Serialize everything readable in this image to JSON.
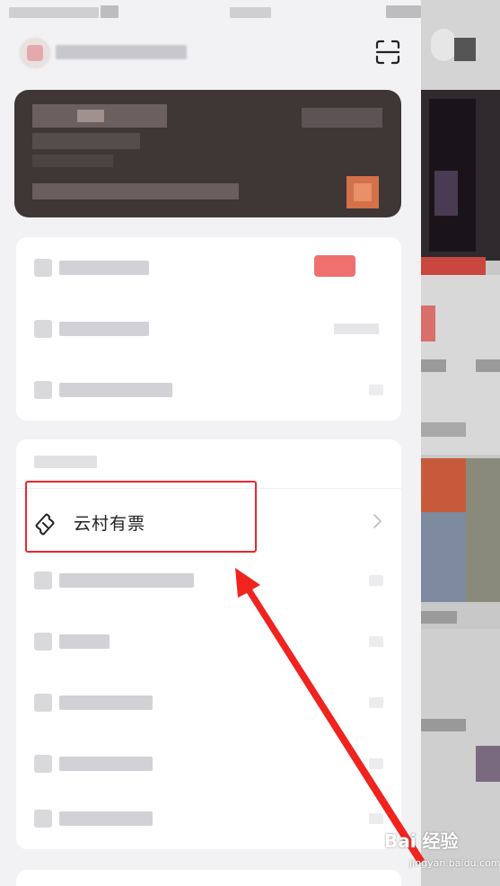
{
  "menu": {
    "featured_item": {
      "label": "云村有票",
      "icon": "ticket-icon",
      "chevron": "chevron-right-icon"
    }
  },
  "annotation": {
    "box_color": "#e8262f",
    "arrow_color": "#f0231f"
  },
  "watermark": {
    "brand": "Bai 经验",
    "url": "jingyan.baidu.com"
  },
  "colors": {
    "drawer_bg": "#f2f2f4",
    "card_bg": "#3f3636",
    "panel_bg": "#ffffff"
  }
}
